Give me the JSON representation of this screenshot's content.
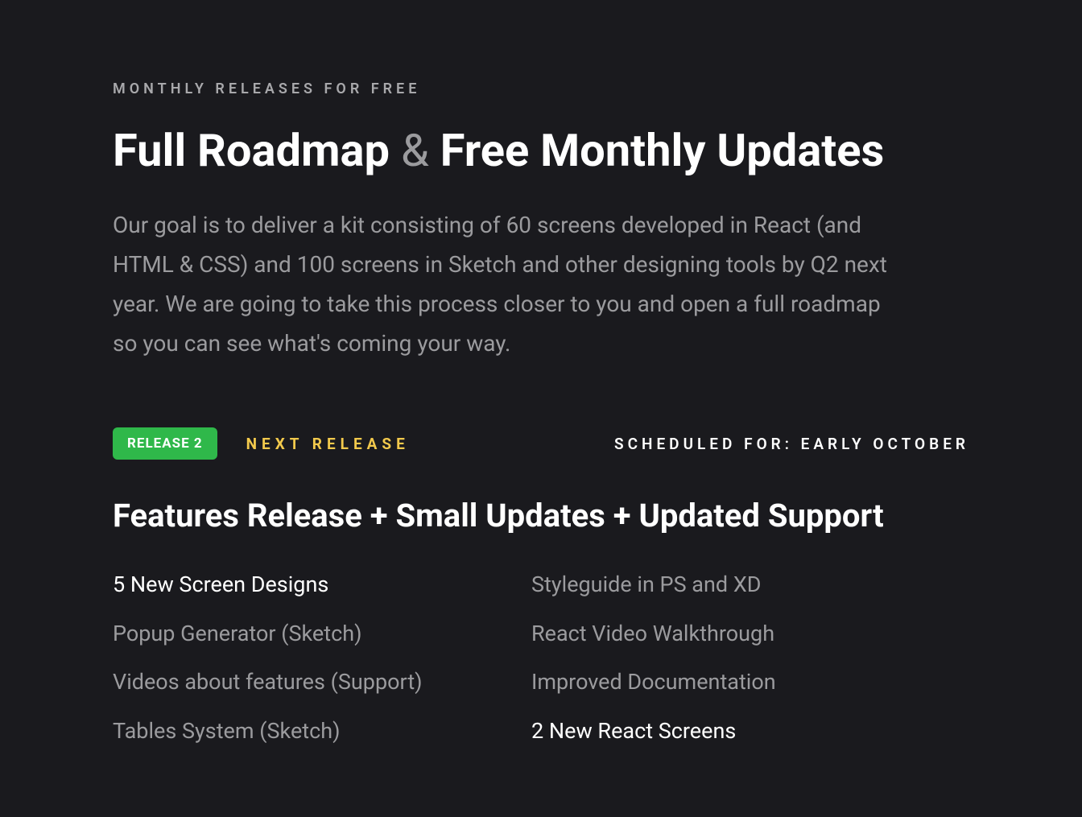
{
  "eyebrow": "MONTHLY RELEASES FOR FREE",
  "headline_part1": "Full Roadmap ",
  "headline_amp": "&",
  "headline_part2": " Free Monthly Updates",
  "lead": "Our goal is to deliver a kit consisting of 60 screens developed in React (and HTML & CSS) and 100 screens in Sketch and other designing tools by Q2 next year. We are going to take this process closer to you and open a full roadmap so you can see what's coming your way.",
  "release_badge": "RELEASE 2",
  "next_release_label": "NEXT RELEASE",
  "scheduled_label": "SCHEDULED FOR: EARLY OCTOBER",
  "subheadline": "Features Release + Small Updates + Updated Support",
  "features_left": [
    {
      "text": "5 New Screen Designs",
      "highlight": true
    },
    {
      "text": "Popup Generator (Sketch)",
      "highlight": false
    },
    {
      "text": "Videos about features (Support)",
      "highlight": false
    },
    {
      "text": "Tables System (Sketch)",
      "highlight": false
    }
  ],
  "features_right": [
    {
      "text": "Styleguide in PS and XD",
      "highlight": false
    },
    {
      "text": "React Video Walkthrough",
      "highlight": false
    },
    {
      "text": "Improved Documentation",
      "highlight": false
    },
    {
      "text": "2 New React Screens",
      "highlight": true
    }
  ]
}
